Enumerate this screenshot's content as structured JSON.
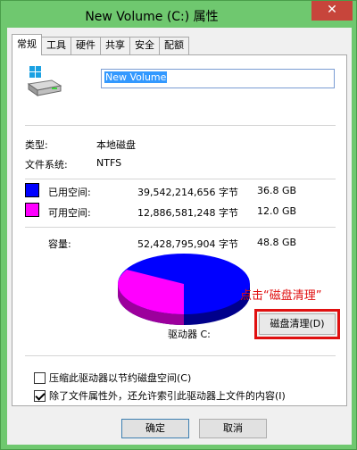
{
  "window": {
    "title": "New Volume (C:) 属性",
    "close_glyph": "✕"
  },
  "tabs": [
    {
      "label": "常规",
      "active": true
    },
    {
      "label": "工具"
    },
    {
      "label": "硬件"
    },
    {
      "label": "共享"
    },
    {
      "label": "安全"
    },
    {
      "label": "配额"
    }
  ],
  "general": {
    "volume_name": "New Volume",
    "type_label": "类型:",
    "type_value": "本地磁盘",
    "fs_label": "文件系统:",
    "fs_value": "NTFS",
    "used": {
      "label": "已用空间:",
      "bytes": "39,542,214,656 字节",
      "size": "36.8 GB",
      "color": "#0000ff"
    },
    "free": {
      "label": "可用空间:",
      "bytes": "12,886,581,248 字节",
      "size": "12.0 GB",
      "color": "#ff00ff"
    },
    "capacity": {
      "label": "容量:",
      "bytes": "52,428,795,904 字节",
      "size": "48.8 GB"
    },
    "drive_label": "驱动器 C:",
    "cleanup_button": "磁盘清理(D)",
    "annotation": "点击“磁盘清理”",
    "compress_option": {
      "label": "压缩此驱动器以节约磁盘空间(C)",
      "checked": false
    },
    "index_option": {
      "label": "除了文件属性外，还允许索引此驱动器上文件的内容(I)",
      "checked": true
    }
  },
  "buttons": {
    "ok": "确定",
    "cancel": "取消"
  },
  "icons": {
    "drive": "hard-drive-icon",
    "close": "close-icon"
  }
}
